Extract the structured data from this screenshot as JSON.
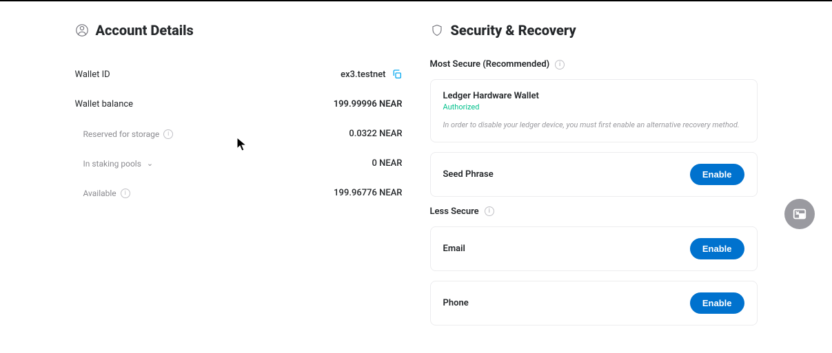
{
  "account": {
    "title": "Account Details",
    "walletIdLabel": "Wallet ID",
    "walletIdValue": "ex3.testnet",
    "balanceLabel": "Wallet balance",
    "balanceValue": "199.99996 NEAR",
    "reservedLabel": "Reserved for storage",
    "reservedValue": "0.0322 NEAR",
    "stakingLabel": "In staking pools",
    "stakingValue": "0 NEAR",
    "availableLabel": "Available",
    "availableValue": "199.96776 NEAR"
  },
  "security": {
    "title": "Security & Recovery",
    "mostSecureLabel": "Most Secure (Recommended)",
    "ledger": {
      "title": "Ledger Hardware Wallet",
      "status": "Authorized",
      "note": "In order to disable your ledger device, you must first enable an alternative recovery method."
    },
    "seed": {
      "title": "Seed Phrase",
      "button": "Enable"
    },
    "lessSecureLabel": "Less Secure",
    "email": {
      "title": "Email",
      "button": "Enable"
    },
    "phone": {
      "title": "Phone",
      "button": "Enable"
    }
  }
}
